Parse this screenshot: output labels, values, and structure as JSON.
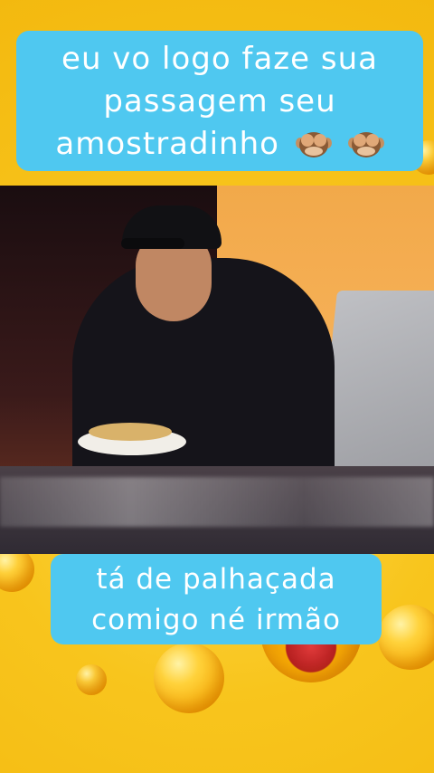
{
  "captions": {
    "top": "eu vo logo faze sua passagem seu amostradinho",
    "bottom_line1": "tá de palhaçada",
    "bottom_line2": "comigo né irmão"
  },
  "icons": {
    "caption_emojis": [
      "see-no-evil-monkey-icon",
      "see-no-evil-monkey-icon"
    ]
  },
  "colors": {
    "caption_bg": "#4fc8f0",
    "background": "#f7c21a"
  }
}
